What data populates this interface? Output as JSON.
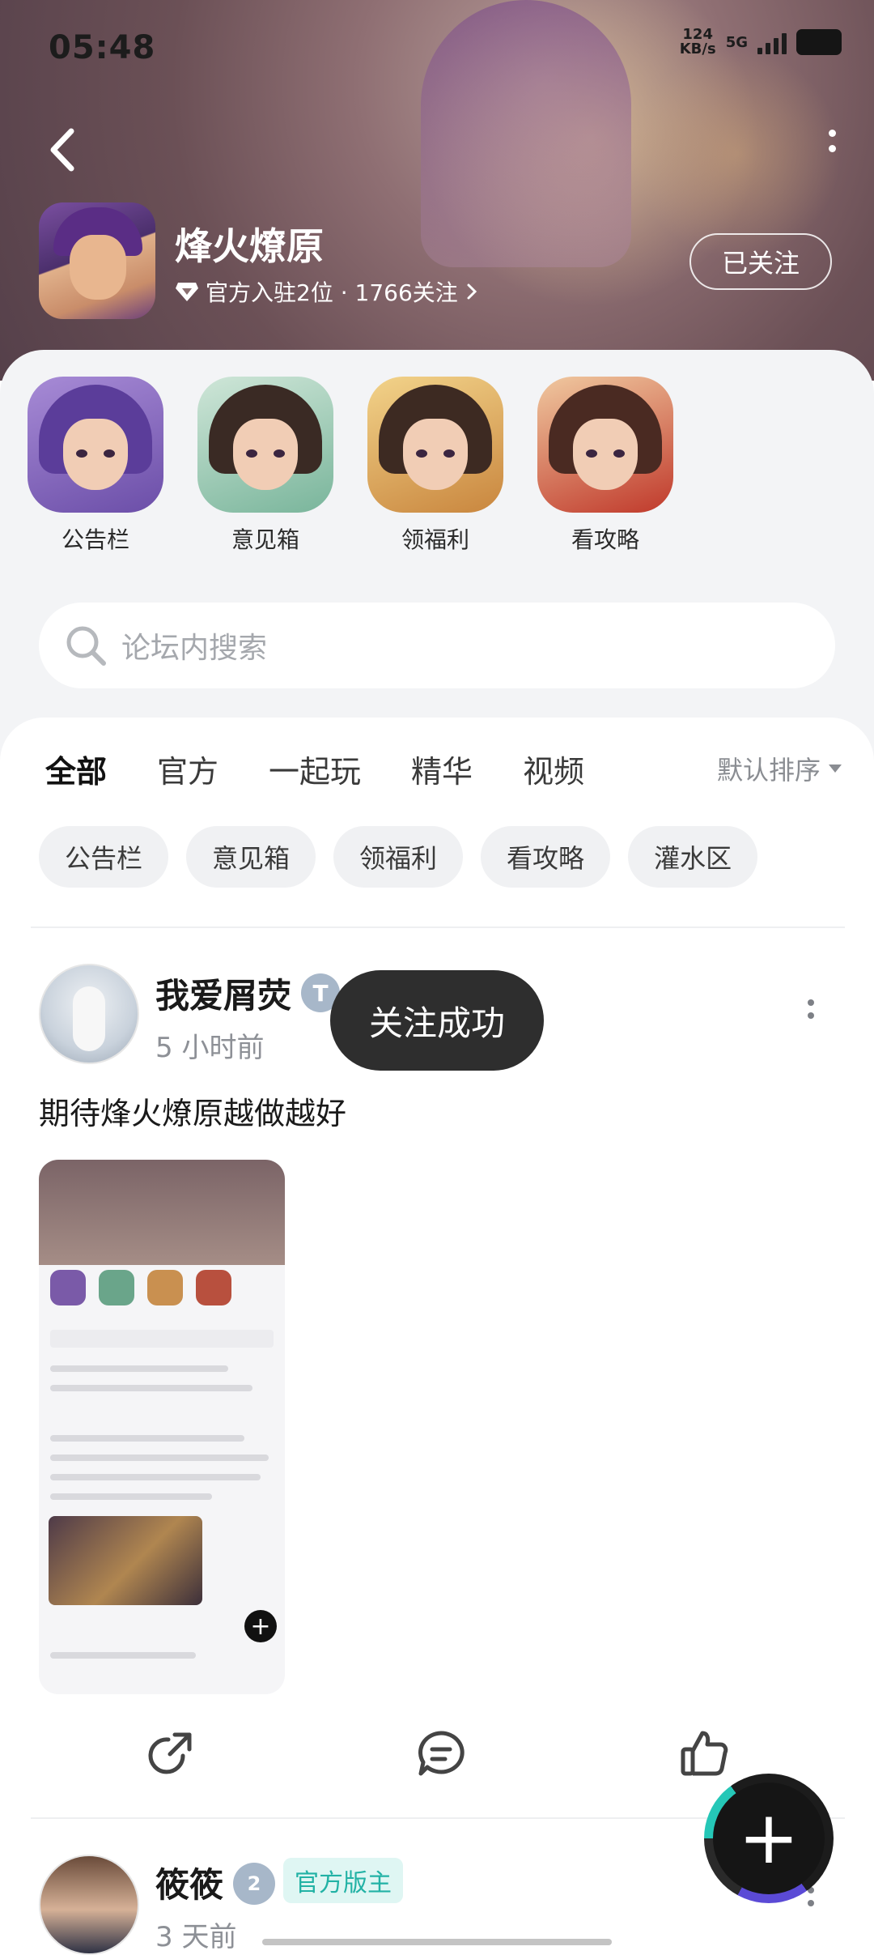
{
  "status_bar": {
    "time": "05:48",
    "net_speed_value": "124",
    "net_speed_unit": "KB/s",
    "network": "5G"
  },
  "header": {
    "forum_name": "烽火燎原",
    "meta": "官方入驻2位 · 1766关注",
    "follow_label": "已关注"
  },
  "shortcuts": [
    {
      "label": "公告栏",
      "hair": "#5b3d9a"
    },
    {
      "label": "意见箱",
      "hair": "#3a2a24"
    },
    {
      "label": "领福利",
      "hair": "#3d2a22"
    },
    {
      "label": "看攻略",
      "hair": "#4a2a22"
    }
  ],
  "search": {
    "placeholder": "论坛内搜索"
  },
  "tabs": [
    {
      "label": "全部",
      "active": true
    },
    {
      "label": "官方"
    },
    {
      "label": "一起玩"
    },
    {
      "label": "精华"
    },
    {
      "label": "视频"
    }
  ],
  "sort_label": "默认排序",
  "chips": [
    "公告栏",
    "意见箱",
    "领福利",
    "看攻略",
    "灌水区"
  ],
  "post1": {
    "user": "我爱屑荧",
    "time": "5 小时前",
    "text": "期待烽火燎原越做越好"
  },
  "post2": {
    "user": "筱筱",
    "badge": "2",
    "role": "官方版主",
    "time": "3 天前"
  },
  "toast": "关注成功",
  "colors": {
    "accent": "#2cc5b8",
    "toast_bg": "#2e2e2e"
  }
}
